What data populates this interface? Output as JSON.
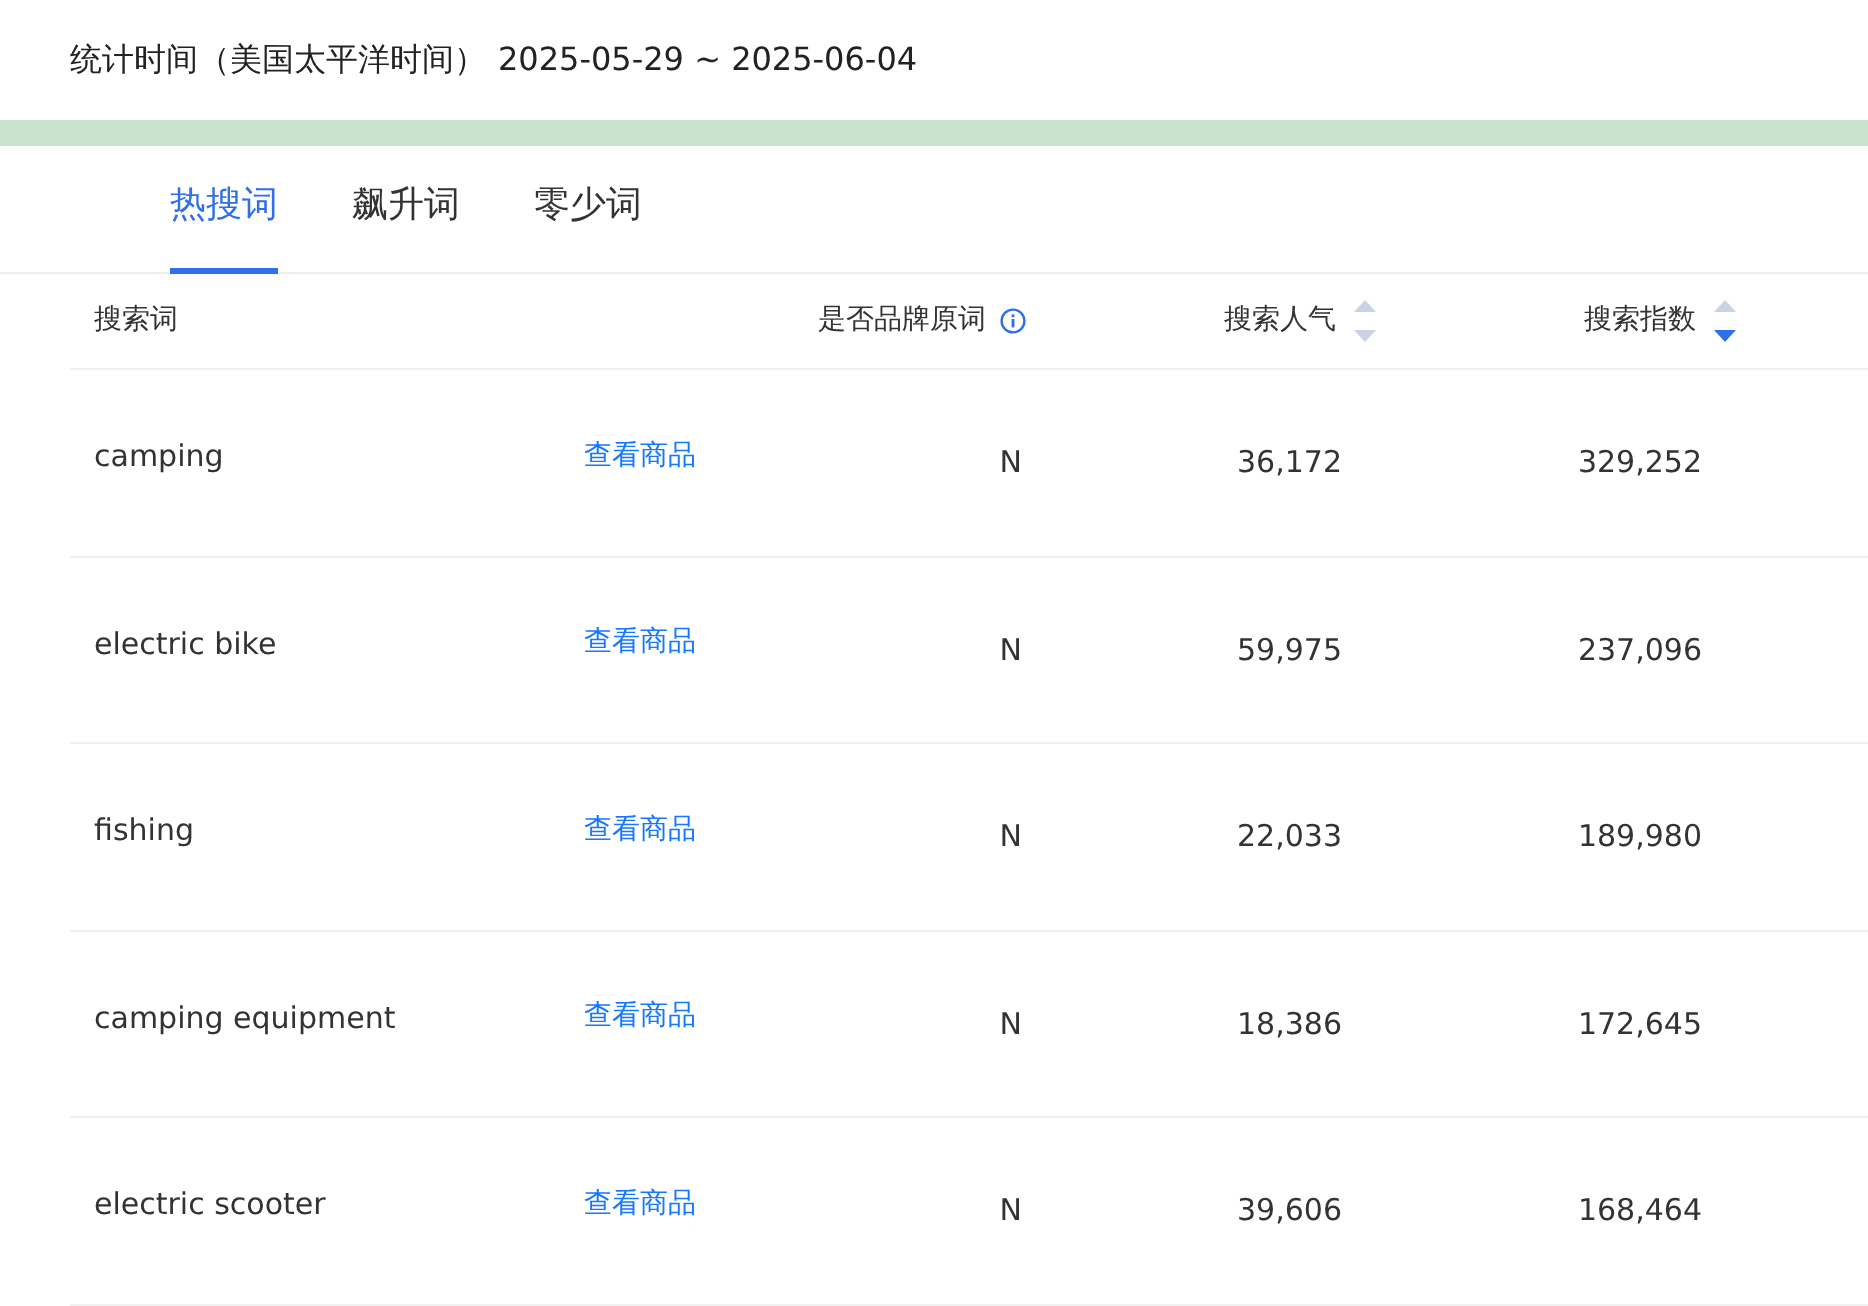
{
  "stat_period": {
    "label": "统计时间（美国太平洋时间）",
    "range": "2025-05-29 ~ 2025-06-04"
  },
  "tabs": [
    {
      "label": "热搜词",
      "selected": true
    },
    {
      "label": "飙升词",
      "selected": false
    },
    {
      "label": "零少词",
      "selected": false
    }
  ],
  "table": {
    "columns": [
      {
        "label": "搜索词",
        "kind": "plain"
      },
      {
        "label": "是否品牌原词",
        "kind": "info"
      },
      {
        "label": "搜索人气",
        "kind": "sortable",
        "descending": false
      },
      {
        "label": "搜索指数",
        "kind": "sortable",
        "descending": true
      }
    ],
    "rows": [
      {
        "term": "camping",
        "link": "查看商品",
        "brand": "N",
        "popularity": "36,172",
        "index": "329,252"
      },
      {
        "term": "electric bike",
        "link": "查看商品",
        "brand": "N",
        "popularity": "59,975",
        "index": "237,096"
      },
      {
        "term": "fishing",
        "link": "查看商品",
        "brand": "N",
        "popularity": "22,033",
        "index": "189,980"
      },
      {
        "term": "camping equipment",
        "link": "查看商品",
        "brand": "N",
        "popularity": "18,386",
        "index": "172,645"
      },
      {
        "term": "electric scooter",
        "link": "查看商品",
        "brand": "N",
        "popularity": "39,606",
        "index": "168,464"
      }
    ]
  }
}
